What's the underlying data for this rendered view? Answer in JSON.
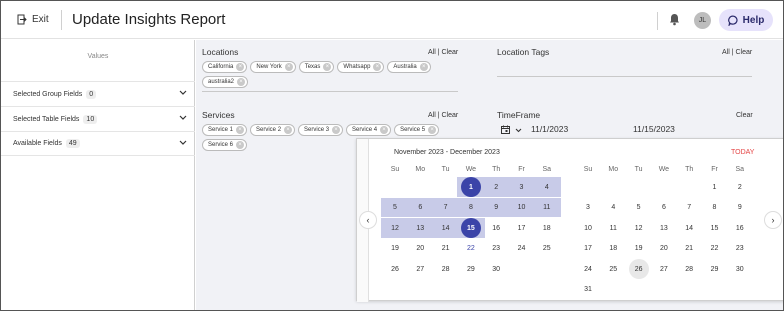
{
  "header": {
    "exit_label": "Exit",
    "title": "Update Insights Report",
    "avatar_initials": "JL",
    "help_label": "Help"
  },
  "left_panel": {
    "values_label": "Values",
    "rows": [
      {
        "label": "Selected Group Fields",
        "count": "0"
      },
      {
        "label": "Selected Table Fields",
        "count": "10"
      },
      {
        "label": "Available Fields",
        "count": "49"
      }
    ]
  },
  "filters": {
    "locations": {
      "label": "Locations",
      "all_clear": "All | Clear",
      "chips": [
        "California",
        "New York",
        "Texas",
        "Whatsapp",
        "Australia",
        "australia2"
      ]
    },
    "location_tags": {
      "label": "Location Tags",
      "all_clear": "All | Clear"
    },
    "services": {
      "label": "Services",
      "all_clear": "All | Clear",
      "chips": [
        "Service 1",
        "Service 2",
        "Service 3",
        "Service 4",
        "Service 5",
        "Service 6"
      ]
    },
    "timeframe": {
      "label": "TimeFrame",
      "clear": "Clear",
      "start_date": "11/1/2023",
      "end_date": "11/15/2023"
    }
  },
  "calendar": {
    "range_title": "November 2023 - December 2023",
    "today_label": "TODAY",
    "weekdays": [
      "Su",
      "Mo",
      "Tu",
      "We",
      "Th",
      "Fr",
      "Sa"
    ],
    "selected_start": "1",
    "selected_end": "15",
    "today_day": "22",
    "december_highlight": "26",
    "november_weeks": [
      [
        "",
        "",
        "",
        "1",
        "2",
        "3",
        "4"
      ],
      [
        "5",
        "6",
        "7",
        "8",
        "9",
        "10",
        "11"
      ],
      [
        "12",
        "13",
        "14",
        "15",
        "16",
        "17",
        "18"
      ],
      [
        "19",
        "20",
        "21",
        "22",
        "23",
        "24",
        "25"
      ],
      [
        "26",
        "27",
        "28",
        "29",
        "30",
        "",
        ""
      ]
    ],
    "december_weeks": [
      [
        "",
        "",
        "",
        "",
        "",
        "1",
        "2"
      ],
      [
        "3",
        "4",
        "5",
        "6",
        "7",
        "8",
        "9"
      ],
      [
        "10",
        "11",
        "12",
        "13",
        "14",
        "15",
        "16"
      ],
      [
        "17",
        "18",
        "19",
        "20",
        "21",
        "22",
        "23"
      ],
      [
        "24",
        "25",
        "26",
        "27",
        "28",
        "29",
        "30"
      ],
      [
        "31",
        "",
        "",
        "",
        "",
        "",
        ""
      ]
    ],
    "colors": {
      "selected": "#3b44a8",
      "range": "#c8cbe8",
      "today_text": "#3b44a8",
      "today_link": "#e54646"
    }
  }
}
